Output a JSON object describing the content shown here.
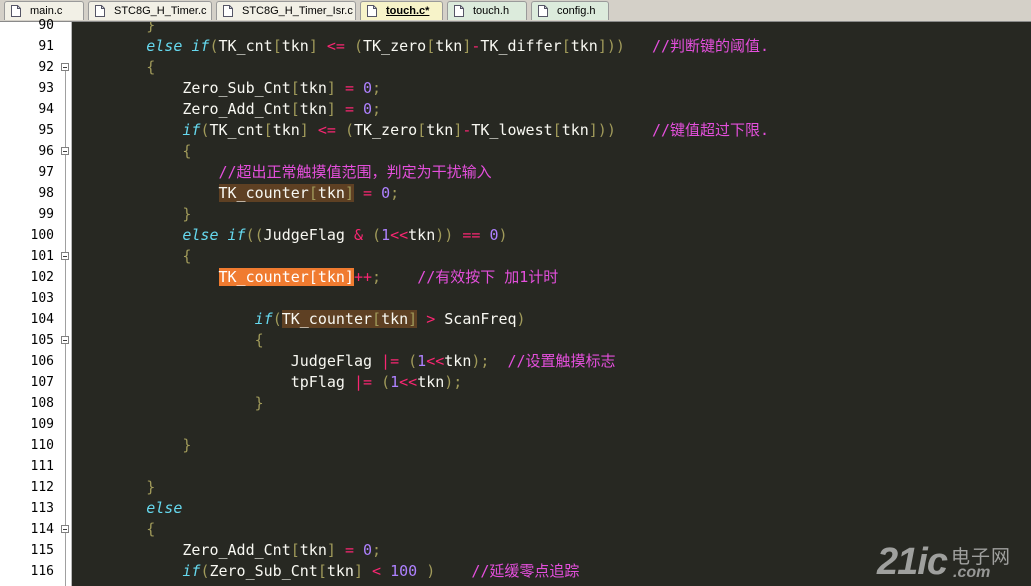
{
  "tabs": [
    {
      "label": "main.c",
      "icon": "c-file-icon",
      "active": false
    },
    {
      "label": "STC8G_H_Timer.c",
      "icon": "c-file-icon",
      "active": false
    },
    {
      "label": "STC8G_H_Timer_Isr.c",
      "icon": "c-file-icon",
      "active": false
    },
    {
      "label": "touch.c*",
      "icon": "c-file-icon",
      "active": true
    },
    {
      "label": "touch.h",
      "icon": "h-file-icon",
      "active": false
    },
    {
      "label": "config.h",
      "icon": "h-file-icon",
      "active": false
    }
  ],
  "code_lines": [
    {
      "num": "90",
      "fold": "",
      "tokens": [
        [
          "        }",
          "b"
        ]
      ]
    },
    {
      "num": "91",
      "fold": "",
      "tokens": [
        [
          "        ",
          ""
        ],
        [
          "else if",
          "k"
        ],
        [
          "(",
          "b"
        ],
        [
          "TK_cnt",
          ""
        ],
        [
          "[",
          "b"
        ],
        [
          "tkn",
          ""
        ],
        [
          "]",
          "b"
        ],
        [
          " ",
          ""
        ],
        [
          "<=",
          "o"
        ],
        [
          " ",
          ""
        ],
        [
          "(",
          "b"
        ],
        [
          "TK_zero",
          ""
        ],
        [
          "[",
          "b"
        ],
        [
          "tkn",
          ""
        ],
        [
          "]",
          "b"
        ],
        [
          "-",
          "o"
        ],
        [
          "TK_differ",
          ""
        ],
        [
          "[",
          "b"
        ],
        [
          "tkn",
          ""
        ],
        [
          "]))",
          "b"
        ],
        [
          "   ",
          ""
        ],
        [
          "//判断键的阈值.",
          "c"
        ]
      ]
    },
    {
      "num": "92",
      "fold": "box",
      "tokens": [
        [
          "        {",
          "b"
        ]
      ]
    },
    {
      "num": "93",
      "fold": "",
      "tokens": [
        [
          "            Zero_Sub_Cnt",
          ""
        ],
        [
          "[",
          "b"
        ],
        [
          "tkn",
          ""
        ],
        [
          "]",
          "b"
        ],
        [
          " ",
          ""
        ],
        [
          "=",
          "o"
        ],
        [
          " ",
          ""
        ],
        [
          "0",
          "n"
        ],
        [
          ";",
          "b"
        ]
      ]
    },
    {
      "num": "94",
      "fold": "",
      "tokens": [
        [
          "            Zero_Add_Cnt",
          ""
        ],
        [
          "[",
          "b"
        ],
        [
          "tkn",
          ""
        ],
        [
          "]",
          "b"
        ],
        [
          " ",
          ""
        ],
        [
          "=",
          "o"
        ],
        [
          " ",
          ""
        ],
        [
          "0",
          "n"
        ],
        [
          ";",
          "b"
        ]
      ]
    },
    {
      "num": "95",
      "fold": "",
      "tokens": [
        [
          "            ",
          ""
        ],
        [
          "if",
          "k"
        ],
        [
          "(",
          "b"
        ],
        [
          "TK_cnt",
          ""
        ],
        [
          "[",
          "b"
        ],
        [
          "tkn",
          ""
        ],
        [
          "]",
          "b"
        ],
        [
          " ",
          ""
        ],
        [
          "<=",
          "o"
        ],
        [
          " ",
          ""
        ],
        [
          "(",
          "b"
        ],
        [
          "TK_zero",
          ""
        ],
        [
          "[",
          "b"
        ],
        [
          "tkn",
          ""
        ],
        [
          "]",
          "b"
        ],
        [
          "-",
          "o"
        ],
        [
          "TK_lowest",
          ""
        ],
        [
          "[",
          "b"
        ],
        [
          "tkn",
          ""
        ],
        [
          "]))",
          "b"
        ],
        [
          "    ",
          ""
        ],
        [
          "//键值超过下限.",
          "c"
        ]
      ]
    },
    {
      "num": "96",
      "fold": "box",
      "tokens": [
        [
          "            {",
          "b"
        ]
      ]
    },
    {
      "num": "97",
      "fold": "",
      "tokens": [
        [
          "                ",
          ""
        ],
        [
          "//超出正常触摸值范围，判定为干扰输入",
          "c"
        ]
      ]
    },
    {
      "num": "98",
      "fold": "",
      "tokens": [
        [
          "                ",
          ""
        ],
        [
          "TK_counter",
          "h"
        ],
        [
          "[",
          "b h"
        ],
        [
          "tkn",
          "h"
        ],
        [
          "]",
          "b h"
        ],
        [
          " ",
          ""
        ],
        [
          "=",
          "o"
        ],
        [
          " ",
          ""
        ],
        [
          "0",
          "n"
        ],
        [
          ";",
          "b"
        ]
      ]
    },
    {
      "num": "99",
      "fold": "",
      "tokens": [
        [
          "            }",
          "b"
        ]
      ]
    },
    {
      "num": "100",
      "fold": "",
      "tokens": [
        [
          "            ",
          ""
        ],
        [
          "else if",
          "k"
        ],
        [
          "((",
          "b"
        ],
        [
          "JudgeFlag",
          ""
        ],
        [
          " ",
          ""
        ],
        [
          "&",
          "o"
        ],
        [
          " ",
          ""
        ],
        [
          "(",
          "b"
        ],
        [
          "1",
          "n"
        ],
        [
          "<<",
          "o"
        ],
        [
          "tkn",
          ""
        ],
        [
          "))",
          "b"
        ],
        [
          " ",
          ""
        ],
        [
          "==",
          "o"
        ],
        [
          " ",
          ""
        ],
        [
          "0",
          "n"
        ],
        [
          ")",
          "b"
        ]
      ]
    },
    {
      "num": "101",
      "fold": "box",
      "tokens": [
        [
          "            {",
          "b"
        ]
      ]
    },
    {
      "num": "102",
      "fold": "",
      "tokens": [
        [
          "                ",
          ""
        ],
        [
          "TK_counter[tkn]",
          "hs"
        ],
        [
          "++",
          "o"
        ],
        [
          ";",
          "b"
        ],
        [
          "    ",
          ""
        ],
        [
          "//有效按下 加1计时",
          "c"
        ]
      ]
    },
    {
      "num": "103",
      "fold": "",
      "tokens": []
    },
    {
      "num": "104",
      "fold": "",
      "tokens": [
        [
          "                    ",
          ""
        ],
        [
          "if",
          "k"
        ],
        [
          "(",
          "b"
        ],
        [
          "TK_counter",
          "h"
        ],
        [
          "[",
          "b h"
        ],
        [
          "tkn",
          "h"
        ],
        [
          "]",
          "b h"
        ],
        [
          " ",
          ""
        ],
        [
          ">",
          "o"
        ],
        [
          " ",
          ""
        ],
        [
          "ScanFreq",
          ""
        ],
        [
          ")",
          "b"
        ]
      ]
    },
    {
      "num": "105",
      "fold": "box",
      "tokens": [
        [
          "                    {",
          "b"
        ]
      ]
    },
    {
      "num": "106",
      "fold": "",
      "tokens": [
        [
          "                        JudgeFlag ",
          ""
        ],
        [
          "|=",
          "o"
        ],
        [
          " ",
          ""
        ],
        [
          "(",
          "b"
        ],
        [
          "1",
          "n"
        ],
        [
          "<<",
          "o"
        ],
        [
          "tkn",
          ""
        ],
        [
          ");",
          "b"
        ],
        [
          "  ",
          ""
        ],
        [
          "//设置触摸标志",
          "c"
        ]
      ]
    },
    {
      "num": "107",
      "fold": "",
      "tokens": [
        [
          "                        tpFlag ",
          ""
        ],
        [
          "|=",
          "o"
        ],
        [
          " ",
          ""
        ],
        [
          "(",
          "b"
        ],
        [
          "1",
          "n"
        ],
        [
          "<<",
          "o"
        ],
        [
          "tkn",
          ""
        ],
        [
          ");",
          "b"
        ]
      ]
    },
    {
      "num": "108",
      "fold": "",
      "tokens": [
        [
          "                    }",
          "b"
        ]
      ]
    },
    {
      "num": "109",
      "fold": "",
      "tokens": []
    },
    {
      "num": "110",
      "fold": "",
      "tokens": [
        [
          "            }",
          "b"
        ]
      ]
    },
    {
      "num": "111",
      "fold": "",
      "tokens": []
    },
    {
      "num": "112",
      "fold": "",
      "tokens": [
        [
          "        }",
          "b"
        ]
      ]
    },
    {
      "num": "113",
      "fold": "",
      "tokens": [
        [
          "        ",
          ""
        ],
        [
          "else",
          "k"
        ]
      ]
    },
    {
      "num": "114",
      "fold": "box",
      "tokens": [
        [
          "        {",
          "b"
        ]
      ]
    },
    {
      "num": "115",
      "fold": "",
      "tokens": [
        [
          "            Zero_Add_Cnt",
          ""
        ],
        [
          "[",
          "b"
        ],
        [
          "tkn",
          ""
        ],
        [
          "]",
          "b"
        ],
        [
          " ",
          ""
        ],
        [
          "=",
          "o"
        ],
        [
          " ",
          ""
        ],
        [
          "0",
          "n"
        ],
        [
          ";",
          "b"
        ]
      ]
    },
    {
      "num": "116",
      "fold": "",
      "tokens": [
        [
          "            ",
          ""
        ],
        [
          "if",
          "k"
        ],
        [
          "(",
          "b"
        ],
        [
          "Zero_Sub_Cnt",
          ""
        ],
        [
          "[",
          "b"
        ],
        [
          "tkn",
          ""
        ],
        [
          "]",
          "b"
        ],
        [
          " ",
          ""
        ],
        [
          "<",
          "o"
        ],
        [
          " ",
          ""
        ],
        [
          "100",
          "n"
        ],
        [
          " )",
          "b"
        ],
        [
          "    ",
          ""
        ],
        [
          "//延缓零点追踪",
          "c"
        ]
      ]
    }
  ],
  "watermark": {
    "main": "21ic",
    "top": "电子网",
    "bottom": ".com"
  },
  "colors": {
    "background": "#272822",
    "keyword": "#66d9ef",
    "operator": "#f92672",
    "number": "#ae81ff",
    "comment": "#e44fdc",
    "bracket": "#a09a5a",
    "highlight": "#5e4023",
    "selection": "#f07b30"
  }
}
